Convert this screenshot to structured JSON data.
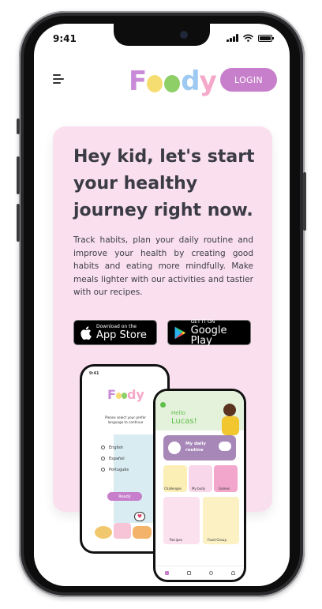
{
  "status_bar": {
    "time": "9:41"
  },
  "header": {
    "logo_text": [
      "F",
      "d",
      "y"
    ],
    "login_label": "LOGIN"
  },
  "hero": {
    "title": "Hey kid, let's start your healthy journey right now.",
    "description": "Track habits, plan your daily routine and improve your health by creating good habits and eating more mindfully. Make meals lighter with our activities and tastier with our recipes.",
    "app_store": {
      "small": "Download on the",
      "big": "App Store"
    },
    "google_play": {
      "small": "GET IT ON",
      "big": "Google Play"
    }
  },
  "mock_left": {
    "time": "9:41",
    "logo_text": [
      "F",
      "dy"
    ],
    "prompt": "Please select your prefer language to continue",
    "options": [
      "English",
      "Español",
      "Português"
    ],
    "ready_label": "Ready"
  },
  "mock_right": {
    "greeting": "Hello",
    "name": "Lucas!",
    "routine_label": "My daily routine",
    "tiles": [
      "Challenges",
      "My body",
      "Games"
    ],
    "bottom_tiles": [
      "Recipes",
      "Food Group"
    ]
  },
  "colors": {
    "accent": "#c77fcb",
    "hero_bg": "#fae0ee",
    "title_text": "#3b3b46",
    "green": "#5fbf4a"
  }
}
